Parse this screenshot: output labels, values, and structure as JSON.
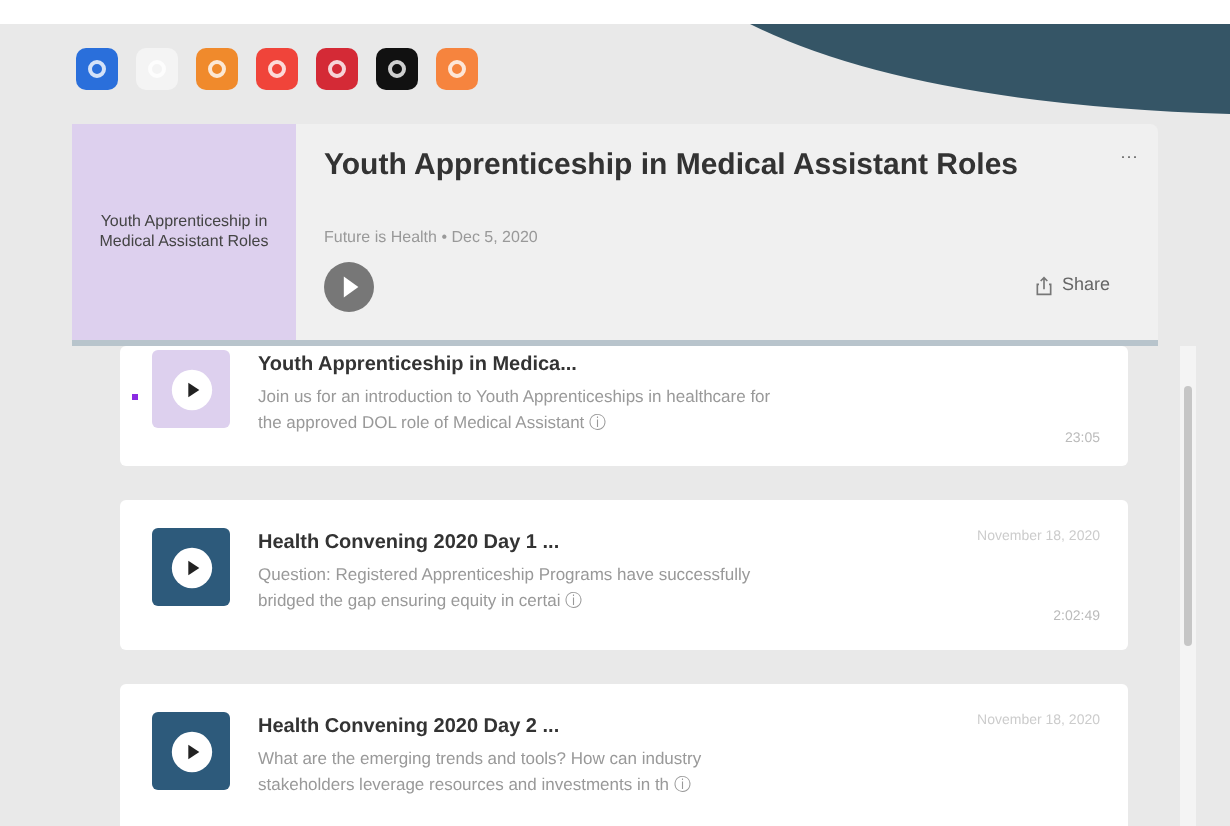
{
  "subscribe_icons": [
    {
      "color": "#2a6fdb"
    },
    {
      "color": "#f4f4f4"
    },
    {
      "color": "#f08a2c"
    },
    {
      "color": "#f0443a"
    },
    {
      "color": "#d42a36"
    },
    {
      "color": "#111111"
    },
    {
      "color": "#f6843e"
    }
  ],
  "player": {
    "cover_title": "Youth Apprenticeship in Medical Assistant Roles",
    "title": "Youth Apprenticeship in Medical Assistant Roles",
    "meta": "Future is Health • Dec 5, 2020",
    "share": "Share",
    "more": "···"
  },
  "episodes": [
    {
      "title": "Youth Apprenticeship in Medica...",
      "description": "Join us for an introduction to Youth Apprenticeships in healthcare for the approved DOL role of Medical Assistant ⓘ",
      "duration": "23:05",
      "unplayed": true,
      "color": "#ddd0ee"
    },
    {
      "title": "Health Convening 2020 Day 1 ...",
      "description": "Question: Registered Apprenticeship Programs have successfully bridged the gap ensuring equity in certai ⓘ",
      "date": "November 18, 2020",
      "duration": "2:02:49",
      "unplayed": false,
      "color": "#2d5a7b"
    },
    {
      "title": "Health Convening 2020 Day 2 ...",
      "description": "What are the emerging trends and tools? How can industry stakeholders leverage resources and investments in th ⓘ",
      "date": "November 18, 2020",
      "unplayed": false,
      "color": "#2d5a7b"
    }
  ]
}
